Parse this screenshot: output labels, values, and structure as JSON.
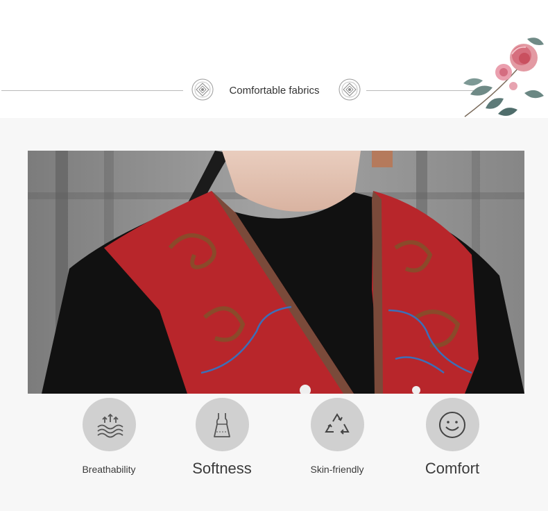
{
  "header": {
    "title": "Comfortable fabrics"
  },
  "features": [
    {
      "label": "Breathability",
      "icon": "breathability-icon"
    },
    {
      "label": "Softness",
      "icon": "dress-icon"
    },
    {
      "label": "Skin-friendly",
      "icon": "recycle-icon"
    },
    {
      "label": "Comfort",
      "icon": "smiley-icon"
    }
  ],
  "colors": {
    "accent_red": "#b8262b",
    "icon_circle": "#d0d0d0",
    "line_gray": "#b9b9b9"
  }
}
